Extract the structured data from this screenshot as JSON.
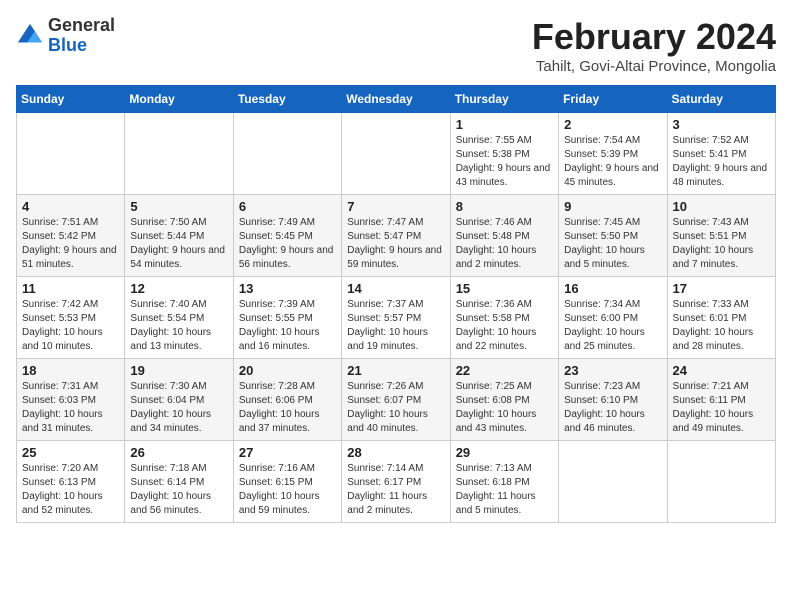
{
  "header": {
    "logo": {
      "line1": "General",
      "line2": "Blue"
    },
    "month_title": "February 2024",
    "location": "Tahilt, Govi-Altai Province, Mongolia"
  },
  "weekdays": [
    "Sunday",
    "Monday",
    "Tuesday",
    "Wednesday",
    "Thursday",
    "Friday",
    "Saturday"
  ],
  "weeks": [
    [
      {
        "day": "",
        "info": ""
      },
      {
        "day": "",
        "info": ""
      },
      {
        "day": "",
        "info": ""
      },
      {
        "day": "",
        "info": ""
      },
      {
        "day": "1",
        "info": "Sunrise: 7:55 AM\nSunset: 5:38 PM\nDaylight: 9 hours and 43 minutes."
      },
      {
        "day": "2",
        "info": "Sunrise: 7:54 AM\nSunset: 5:39 PM\nDaylight: 9 hours and 45 minutes."
      },
      {
        "day": "3",
        "info": "Sunrise: 7:52 AM\nSunset: 5:41 PM\nDaylight: 9 hours and 48 minutes."
      }
    ],
    [
      {
        "day": "4",
        "info": "Sunrise: 7:51 AM\nSunset: 5:42 PM\nDaylight: 9 hours and 51 minutes."
      },
      {
        "day": "5",
        "info": "Sunrise: 7:50 AM\nSunset: 5:44 PM\nDaylight: 9 hours and 54 minutes."
      },
      {
        "day": "6",
        "info": "Sunrise: 7:49 AM\nSunset: 5:45 PM\nDaylight: 9 hours and 56 minutes."
      },
      {
        "day": "7",
        "info": "Sunrise: 7:47 AM\nSunset: 5:47 PM\nDaylight: 9 hours and 59 minutes."
      },
      {
        "day": "8",
        "info": "Sunrise: 7:46 AM\nSunset: 5:48 PM\nDaylight: 10 hours and 2 minutes."
      },
      {
        "day": "9",
        "info": "Sunrise: 7:45 AM\nSunset: 5:50 PM\nDaylight: 10 hours and 5 minutes."
      },
      {
        "day": "10",
        "info": "Sunrise: 7:43 AM\nSunset: 5:51 PM\nDaylight: 10 hours and 7 minutes."
      }
    ],
    [
      {
        "day": "11",
        "info": "Sunrise: 7:42 AM\nSunset: 5:53 PM\nDaylight: 10 hours and 10 minutes."
      },
      {
        "day": "12",
        "info": "Sunrise: 7:40 AM\nSunset: 5:54 PM\nDaylight: 10 hours and 13 minutes."
      },
      {
        "day": "13",
        "info": "Sunrise: 7:39 AM\nSunset: 5:55 PM\nDaylight: 10 hours and 16 minutes."
      },
      {
        "day": "14",
        "info": "Sunrise: 7:37 AM\nSunset: 5:57 PM\nDaylight: 10 hours and 19 minutes."
      },
      {
        "day": "15",
        "info": "Sunrise: 7:36 AM\nSunset: 5:58 PM\nDaylight: 10 hours and 22 minutes."
      },
      {
        "day": "16",
        "info": "Sunrise: 7:34 AM\nSunset: 6:00 PM\nDaylight: 10 hours and 25 minutes."
      },
      {
        "day": "17",
        "info": "Sunrise: 7:33 AM\nSunset: 6:01 PM\nDaylight: 10 hours and 28 minutes."
      }
    ],
    [
      {
        "day": "18",
        "info": "Sunrise: 7:31 AM\nSunset: 6:03 PM\nDaylight: 10 hours and 31 minutes."
      },
      {
        "day": "19",
        "info": "Sunrise: 7:30 AM\nSunset: 6:04 PM\nDaylight: 10 hours and 34 minutes."
      },
      {
        "day": "20",
        "info": "Sunrise: 7:28 AM\nSunset: 6:06 PM\nDaylight: 10 hours and 37 minutes."
      },
      {
        "day": "21",
        "info": "Sunrise: 7:26 AM\nSunset: 6:07 PM\nDaylight: 10 hours and 40 minutes."
      },
      {
        "day": "22",
        "info": "Sunrise: 7:25 AM\nSunset: 6:08 PM\nDaylight: 10 hours and 43 minutes."
      },
      {
        "day": "23",
        "info": "Sunrise: 7:23 AM\nSunset: 6:10 PM\nDaylight: 10 hours and 46 minutes."
      },
      {
        "day": "24",
        "info": "Sunrise: 7:21 AM\nSunset: 6:11 PM\nDaylight: 10 hours and 49 minutes."
      }
    ],
    [
      {
        "day": "25",
        "info": "Sunrise: 7:20 AM\nSunset: 6:13 PM\nDaylight: 10 hours and 52 minutes."
      },
      {
        "day": "26",
        "info": "Sunrise: 7:18 AM\nSunset: 6:14 PM\nDaylight: 10 hours and 56 minutes."
      },
      {
        "day": "27",
        "info": "Sunrise: 7:16 AM\nSunset: 6:15 PM\nDaylight: 10 hours and 59 minutes."
      },
      {
        "day": "28",
        "info": "Sunrise: 7:14 AM\nSunset: 6:17 PM\nDaylight: 11 hours and 2 minutes."
      },
      {
        "day": "29",
        "info": "Sunrise: 7:13 AM\nSunset: 6:18 PM\nDaylight: 11 hours and 5 minutes."
      },
      {
        "day": "",
        "info": ""
      },
      {
        "day": "",
        "info": ""
      }
    ]
  ]
}
